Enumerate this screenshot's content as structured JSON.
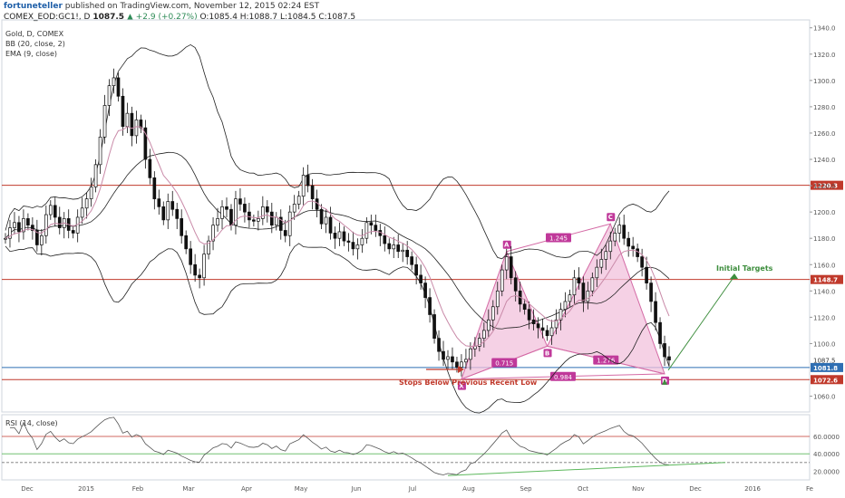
{
  "header": {
    "publisher": "fortuneteller",
    "published_text": "published on TradingView.com, November 12, 2015 02:24 EST",
    "symbol": "COMEX_EOD:GC1!, D",
    "last": "1087.5",
    "change": "▲ +2.9 (+0.27%)",
    "ohlc": "O:1085.4 H:1088.7 L:1084.5 C:1087.5"
  },
  "legend": {
    "title": "Gold, D, COMEX",
    "bb": "BB (20, close, 2)",
    "ema": "EMA (9, close)"
  },
  "rsi_label": "RSI (14, close)",
  "colors": {
    "candle": "#111111",
    "bb": "#222222",
    "ema": "#c98aa8",
    "pattern_fill": "#f2c2dc",
    "pattern_line": "#d46aa5",
    "pattern_label_bg": "#c0399a",
    "resistance": "#c0392b",
    "support_blue": "#2f6fb3",
    "target_arrow": "#3e8e3e",
    "rsi_line": "#555555",
    "rsi_green": "#5cb85c"
  },
  "annotations": {
    "stops": "Stops Below Previous Recent Low",
    "targets": "Initial Targets"
  },
  "chart_data": {
    "type": "candlestick",
    "title": "Gold, D, COMEX",
    "x_ticks": [
      "Dec",
      "2015",
      "Feb",
      "Mar",
      "Apr",
      "May",
      "Jun",
      "Jul",
      "Aug",
      "Sep",
      "Oct",
      "Nov",
      "Dec",
      "2016",
      "Fe"
    ],
    "y_ticks": [
      1340,
      1320,
      1300,
      1280,
      1260,
      1240,
      1220,
      1200,
      1180,
      1160,
      1140,
      1120,
      1100,
      1087.5,
      1060
    ],
    "ylim": [
      1048,
      1346
    ],
    "levels": [
      {
        "name": "1220.3",
        "value": 1220.3,
        "label": "1220.3",
        "color": "#c0392b"
      },
      {
        "name": "1148.7",
        "value": 1148.7,
        "label": "1148.7",
        "color": "#c0392b"
      },
      {
        "name": "1081.8",
        "value": 1081.8,
        "label": "1081.8",
        "color": "#2f6fb3"
      },
      {
        "name": "1072.6",
        "value": 1072.6,
        "label": "1072.6",
        "color": "#c0392b"
      }
    ],
    "current_price_label": "1087.5",
    "pattern": {
      "points": [
        {
          "name": "X",
          "date_index": 101,
          "price": 1073
        },
        {
          "name": "A",
          "date_index": 111,
          "price": 1170
        },
        {
          "name": "B",
          "date_index": 120,
          "price": 1098
        },
        {
          "name": "C",
          "date_index": 134,
          "price": 1191
        },
        {
          "name": "D",
          "date_index": 146,
          "price": 1077
        }
      ],
      "ratios": [
        "0.715",
        "1.245",
        "1.276",
        "0.984"
      ]
    },
    "ohlc_close_path": [
      1180,
      1188,
      1192,
      1185,
      1195,
      1190,
      1186,
      1175,
      1182,
      1198,
      1205,
      1196,
      1188,
      1195,
      1186,
      1184,
      1196,
      1203,
      1210,
      1219,
      1236,
      1257,
      1281,
      1296,
      1302,
      1288,
      1265,
      1275,
      1258,
      1270,
      1264,
      1240,
      1226,
      1210,
      1204,
      1194,
      1208,
      1202,
      1195,
      1182,
      1172,
      1160,
      1152,
      1150,
      1168,
      1178,
      1190,
      1195,
      1204,
      1202,
      1190,
      1210,
      1206,
      1200,
      1194,
      1193,
      1195,
      1204,
      1200,
      1190,
      1196,
      1186,
      1182,
      1200,
      1206,
      1212,
      1228,
      1220,
      1210,
      1202,
      1191,
      1196,
      1184,
      1180,
      1185,
      1178,
      1177,
      1172,
      1175,
      1180,
      1192,
      1190,
      1186,
      1182,
      1176,
      1172,
      1175,
      1170,
      1171,
      1166,
      1160,
      1152,
      1146,
      1135,
      1122,
      1104,
      1094,
      1088,
      1090,
      1086,
      1082,
      1086,
      1088,
      1096,
      1098,
      1104,
      1110,
      1118,
      1128,
      1140,
      1156,
      1166,
      1150,
      1140,
      1130,
      1126,
      1118,
      1115,
      1112,
      1110,
      1106,
      1112,
      1118,
      1126,
      1132,
      1137,
      1150,
      1146,
      1132,
      1140,
      1150,
      1158,
      1164,
      1170,
      1178,
      1184,
      1190,
      1180,
      1174,
      1172,
      1166,
      1158,
      1146,
      1132,
      1116,
      1100,
      1090,
      1087.5
    ],
    "rsi": {
      "levels": [
        60,
        40,
        30
      ],
      "y_ticks": [
        60,
        40,
        20
      ],
      "ylim": [
        10,
        85
      ]
    }
  }
}
